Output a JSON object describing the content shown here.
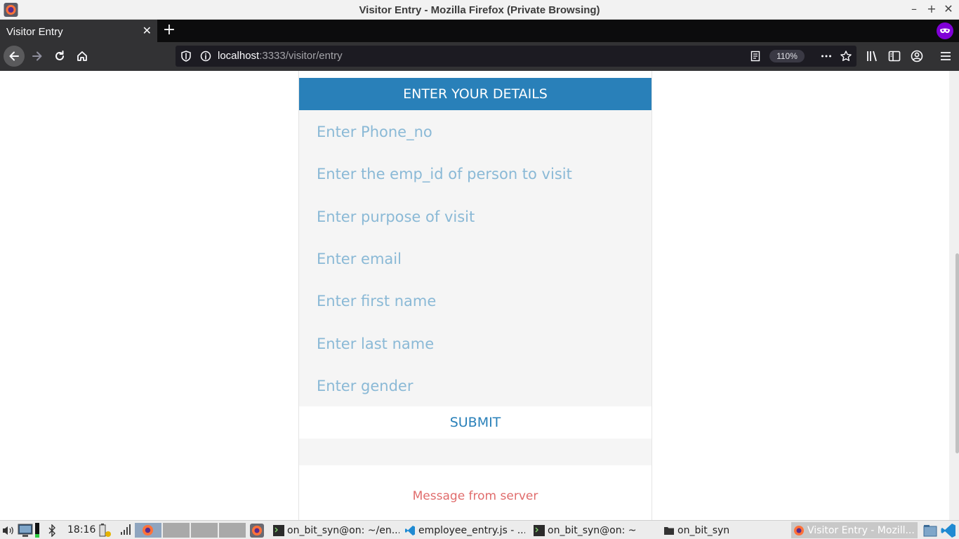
{
  "window": {
    "title": "Visitor Entry - Mozilla Firefox (Private Browsing)"
  },
  "tabs": [
    {
      "title": "Visitor Entry"
    }
  ],
  "navbar": {
    "url_host": "localhost",
    "url_rest": ":3333/visitor/entry",
    "zoom": "110%"
  },
  "form": {
    "header": "ENTER YOUR DETAILS",
    "fields": [
      {
        "placeholder": "Enter Phone_no"
      },
      {
        "placeholder": "Enter the emp_id of person to visit"
      },
      {
        "placeholder": "Enter purpose of visit"
      },
      {
        "placeholder": "Enter email"
      },
      {
        "placeholder": "Enter first name"
      },
      {
        "placeholder": "Enter last name"
      },
      {
        "placeholder": "Enter gender"
      }
    ],
    "submit_label": "SUBMIT",
    "server_message": "Message from server"
  },
  "taskbar": {
    "clock": "18:16",
    "items": [
      {
        "label": "on_bit_syn@on: ~/en...",
        "icon": "terminal-icon"
      },
      {
        "label": "employee_entry.js - ...",
        "icon": "vscode-icon"
      },
      {
        "label": "on_bit_syn@on: ~",
        "icon": "terminal-icon"
      },
      {
        "label": "on_bit_syn",
        "icon": "folder-icon"
      },
      {
        "label": "Visitor Entry - Mozill...",
        "icon": "firefox-icon"
      }
    ]
  },
  "colors": {
    "accent": "#2980b9",
    "placeholder": "#8ab9d6",
    "server_message": "#e06c6c",
    "private_badge": "#8000d7"
  }
}
